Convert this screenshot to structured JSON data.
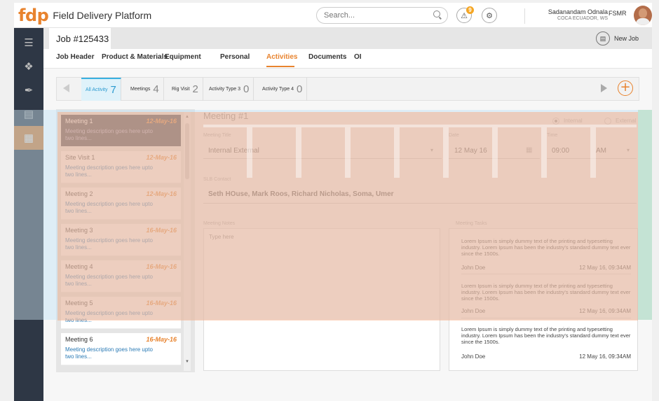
{
  "app": {
    "logo": "fdp",
    "title": "Field Delivery Platform"
  },
  "search": {
    "placeholder": "Search..."
  },
  "notifications": {
    "count": "9"
  },
  "user": {
    "name": "Sadanandam Odnala",
    "org": "COCA ECUADOR, WS",
    "role": "FSMR"
  },
  "job": {
    "title": "Job #125433",
    "new_job_label": "New Job"
  },
  "tabs": [
    "Job Header",
    "Product & Materials",
    "Equipment",
    "Personal",
    "Activities",
    "Documents",
    "OI"
  ],
  "activity_tabs": [
    {
      "label": "All Activity",
      "count": "7"
    },
    {
      "label": "Meetings",
      "count": "4"
    },
    {
      "label": "Rig Visit",
      "count": "2"
    },
    {
      "label": "Activity Type 3",
      "count": "0"
    },
    {
      "label": "Activity Type 4",
      "count": "0"
    }
  ],
  "meetings": [
    {
      "title": "Meeting 1",
      "date": "12-May-16",
      "desc": "Meeting description goes here upto two lines..."
    },
    {
      "title": "Site Visit 1",
      "date": "12-May-16",
      "desc": "Meeting description goes here upto two lines..."
    },
    {
      "title": "Meeting 2",
      "date": "12-May-16",
      "desc": "Meeting description goes here upto two lines..."
    },
    {
      "title": "Meeting 3",
      "date": "16-May-16",
      "desc": "Meeting description goes here upto two lines..."
    },
    {
      "title": "Meeting 4",
      "date": "16-May-16",
      "desc": "Meeting description goes here upto two lines..."
    },
    {
      "title": "Meeting 5",
      "date": "16-May-16",
      "desc": "Meeting description goes here upto two lines..."
    },
    {
      "title": "Meeting 6",
      "date": "16-May-16",
      "desc": "Meeting description goes here upto two lines..."
    }
  ],
  "detail": {
    "heading": "Meeting #1",
    "radio_internal": "Internal",
    "radio_external": "External",
    "meeting_title_label": "Meeting Title",
    "meeting_title_value": "Internal External",
    "date_label": "Date",
    "date_value": "12 May 16",
    "time_label": "Time",
    "time_value": "09:00",
    "ampm": "AM",
    "contact_label": "SLB Contact",
    "contact_value": "Seth HOuse, Mark Roos, Richard Nicholas, Soma, Umer",
    "notes_label": "Meeting Notes",
    "notes_placeholder": "Type here",
    "tasks_label": "Meeting Tasks"
  },
  "tasks": [
    {
      "text": "Lorem Ipsum is simply dummy text of the printing and typesetting industry. Lorem Ipsum has been the industry's standard dummy text ever since the 1500s.",
      "author": "John Doe",
      "when": "12 May 16, 09:34AM"
    },
    {
      "text": "Lorem Ipsum is simply dummy text of the printing and typesetting industry. Lorem Ipsum has been the industry's standard dummy text ever since the 1500s.",
      "author": "John Doe",
      "when": "12 May 16, 09:34AM"
    },
    {
      "text": "Lorem Ipsum is simply dummy text of the printing and typesetting industry. Lorem Ipsum has been the industry's standard dummy text ever since the 1500s.",
      "author": "John Doe",
      "when": "12 May 16, 09:34AM"
    }
  ],
  "colors": {
    "accent": "#e8832e",
    "sidebar": "#2e3745",
    "link": "#2a7ab5",
    "tab_active": "#3ab0e0"
  }
}
